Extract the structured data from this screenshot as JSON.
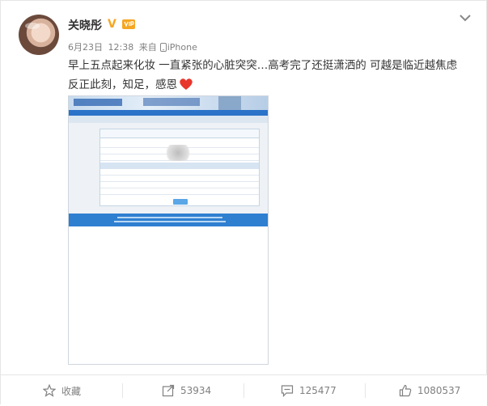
{
  "post": {
    "username": "关晓彤",
    "verified_mark": "V",
    "date": "6月23日",
    "time": "12:38",
    "source_prefix": "来自",
    "source_device": "iPhone",
    "text_line1": "早上五点起来化妆 一直紧张的心脏突突…高考完了还挺潇洒的 可越是临近越焦虑",
    "text_line2": "反正此刻，知足，感恩"
  },
  "actions": {
    "favorite_label": "收藏",
    "repost_count": "53934",
    "comment_count": "125477",
    "like_count": "1080537"
  },
  "colors": {
    "verified": "#f5a623",
    "heart": "#e8362d",
    "banner_blue": "#2f7fd1",
    "text_gray": "#808080"
  },
  "icons": [
    "chevron-down-icon",
    "vip-icon",
    "phone-icon",
    "heart-emoji-icon",
    "star-icon",
    "repost-icon",
    "comment-icon",
    "like-icon"
  ]
}
